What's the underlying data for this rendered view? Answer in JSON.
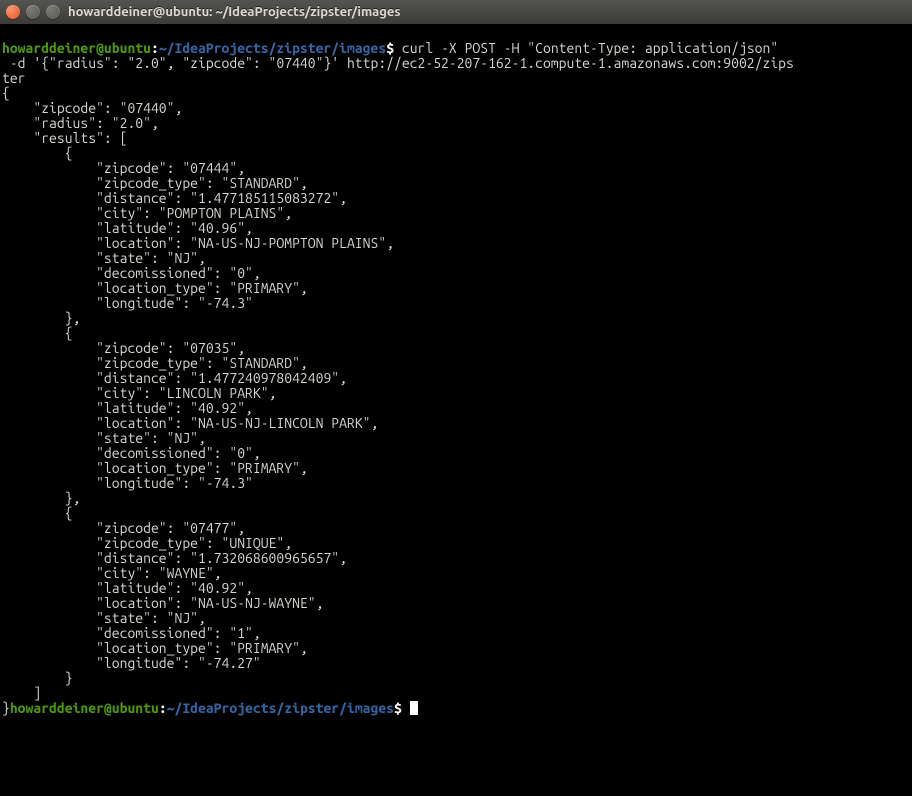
{
  "window": {
    "title": "howarddeiner@ubuntu: ~/IdeaProjects/zipster/images"
  },
  "prompt": {
    "user_host": "howarddeiner@ubuntu",
    "colon": ":",
    "path_prefix": "~",
    "path_rest": "/IdeaProjects/zipster/images",
    "dollar": "$"
  },
  "command": {
    "line1": " curl -X POST -H \"Content-Type: application/json\"",
    "line2_prefix": " -d '{\"radius\": \"2.0\", \"zipcode\": \"07440\"}' http://ec2-52-207-162-1.compute-1.amazonaws.com:9002/zips",
    "line3": "ter"
  },
  "output": {
    "open_brace": "{",
    "zipcode_line": "    \"zipcode\": \"07440\",",
    "radius_line": "    \"radius\": \"2.0\",",
    "results_open": "    \"results\": [",
    "obj_open": "        {",
    "obj_close_comma": "        },",
    "obj_close": "        }",
    "arr_close": "    ]",
    "close_brace": "}",
    "blank": "",
    "r1": {
      "zipcode": "            \"zipcode\": \"07444\",",
      "zipcode_type": "            \"zipcode_type\": \"STANDARD\",",
      "distance": "            \"distance\": \"1.477185115083272\",",
      "city": "            \"city\": \"POMPTON PLAINS\",",
      "latitude": "            \"latitude\": \"40.96\",",
      "location": "            \"location\": \"NA-US-NJ-POMPTON PLAINS\",",
      "state": "            \"state\": \"NJ\",",
      "decomissioned": "            \"decomissioned\": \"0\",",
      "location_type": "            \"location_type\": \"PRIMARY\",",
      "longitude": "            \"longitude\": \"-74.3\""
    },
    "r2": {
      "zipcode": "            \"zipcode\": \"07035\",",
      "zipcode_type": "            \"zipcode_type\": \"STANDARD\",",
      "distance": "            \"distance\": \"1.477240978042409\",",
      "city": "            \"city\": \"LINCOLN PARK\",",
      "latitude": "            \"latitude\": \"40.92\",",
      "location": "            \"location\": \"NA-US-NJ-LINCOLN PARK\",",
      "state": "            \"state\": \"NJ\",",
      "decomissioned": "            \"decomissioned\": \"0\",",
      "location_type": "            \"location_type\": \"PRIMARY\",",
      "longitude": "            \"longitude\": \"-74.3\""
    },
    "r3": {
      "zipcode": "            \"zipcode\": \"07477\",",
      "zipcode_type": "            \"zipcode_type\": \"UNIQUE\",",
      "distance": "            \"distance\": \"1.732068600965657\",",
      "city": "            \"city\": \"WAYNE\",",
      "latitude": "            \"latitude\": \"40.92\",",
      "location": "            \"location\": \"NA-US-NJ-WAYNE\",",
      "state": "            \"state\": \"NJ\",",
      "decomissioned": "            \"decomissioned\": \"1\",",
      "location_type": "            \"location_type\": \"PRIMARY\",",
      "longitude": "            \"longitude\": \"-74.27\""
    }
  }
}
